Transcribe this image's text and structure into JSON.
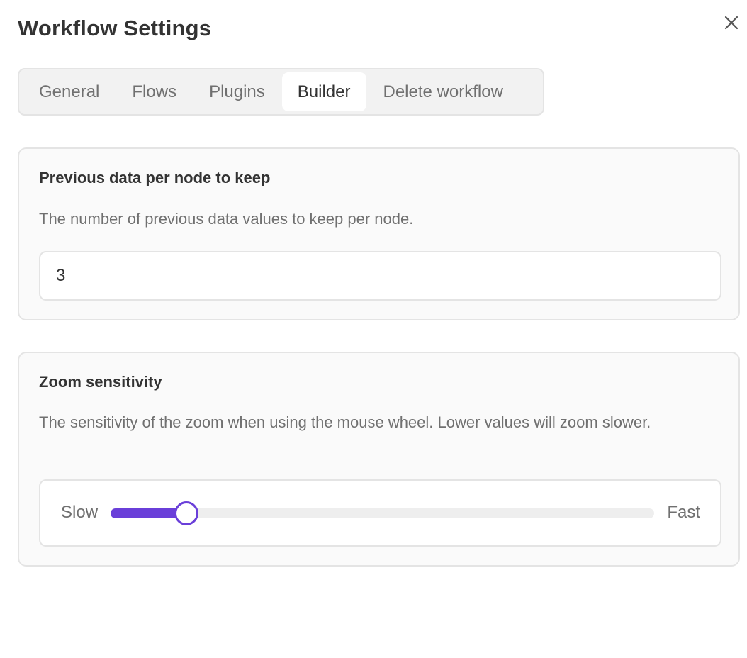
{
  "dialog": {
    "title": "Workflow Settings",
    "close_icon": "close-icon"
  },
  "tabs": [
    {
      "label": "General",
      "active": false
    },
    {
      "label": "Flows",
      "active": false
    },
    {
      "label": "Plugins",
      "active": false
    },
    {
      "label": "Builder",
      "active": true
    },
    {
      "label": "Delete workflow",
      "active": false
    }
  ],
  "history_setting": {
    "heading": "Previous data per node to keep",
    "description": "The number of previous data values to keep per node.",
    "value": "3"
  },
  "zoom_setting": {
    "heading": "Zoom sensitivity",
    "description": "The sensitivity of the zoom when using the mouse wheel. Lower values will zoom slower.",
    "min_label": "Slow",
    "max_label": "Fast",
    "value_fraction": 0.14
  },
  "colors": {
    "accent": "#6a3fd9",
    "text": "#333333",
    "muted_text": "#707070",
    "border": "#e4e4e4",
    "card_bg": "#fafafa"
  }
}
